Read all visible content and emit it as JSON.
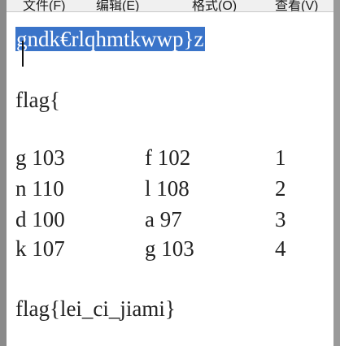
{
  "menu": {
    "items": [
      "文件(F)",
      "编辑(E)",
      "格式(O)",
      "查看(V)"
    ]
  },
  "editor": {
    "selected_line": "gndk€rlqhmtkwwp}z",
    "line_flag_open": "flag{",
    "table": [
      [
        "g 103",
        "f 102",
        "1"
      ],
      [
        "n 110",
        "l 108",
        "2"
      ],
      [
        "d 100",
        "a 97",
        "3"
      ],
      [
        "k 107",
        "g 103",
        "4"
      ]
    ],
    "final_flag": "flag{lei_ci_jiami}"
  },
  "colors": {
    "selection": "#3a74c9",
    "text": "#222222",
    "menubar": "#f0f0f0"
  }
}
